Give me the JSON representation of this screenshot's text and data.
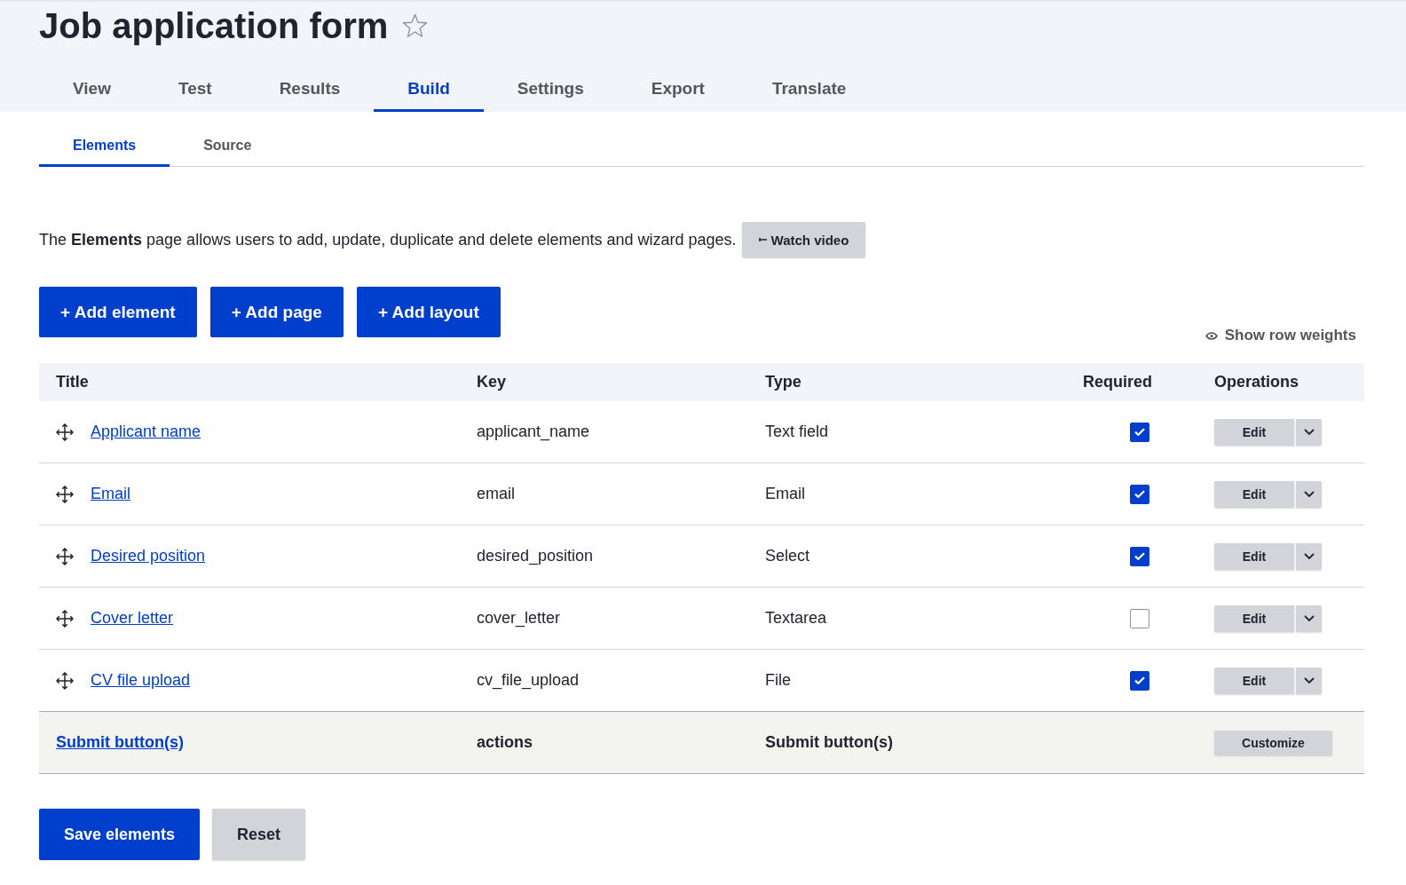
{
  "page": {
    "title": "Job application form",
    "starred": false
  },
  "primary_tabs": [
    {
      "label": "View",
      "selected": false
    },
    {
      "label": "Test",
      "selected": false
    },
    {
      "label": "Results",
      "selected": false
    },
    {
      "label": "Build",
      "selected": true
    },
    {
      "label": "Settings",
      "selected": false
    },
    {
      "label": "Export",
      "selected": false
    },
    {
      "label": "Translate",
      "selected": false
    }
  ],
  "secondary_tabs": [
    {
      "label": "Elements",
      "selected": true
    },
    {
      "label": "Source",
      "selected": false
    }
  ],
  "description": "The **Elements** page allows users to add, update, duplicate and delete elements and wizard pages.",
  "watch_video_button": "Watch video",
  "add_buttons": [
    "+ Add element",
    "+ Add page",
    "+ Add layout"
  ],
  "row_weights_toggle": "Show row weights",
  "table": {
    "columns": [
      "Title",
      "Key",
      "Type",
      "Required",
      "Operations"
    ],
    "rows": [
      {
        "title": "Applicant name",
        "key": "applicant_name",
        "type": "Text field",
        "required": true,
        "operation": "Edit"
      },
      {
        "title": "Email",
        "key": "email",
        "type": "Email",
        "required": true,
        "operation": "Edit"
      },
      {
        "title": "Desired position",
        "key": "desired_position",
        "type": "Select",
        "required": true,
        "operation": "Edit"
      },
      {
        "title": "Cover letter",
        "key": "cover_letter",
        "type": "Textarea",
        "required": false,
        "operation": "Edit"
      },
      {
        "title": "CV file upload",
        "key": "cv_file_upload",
        "type": "File",
        "required": true,
        "operation": "Edit"
      }
    ],
    "summary_row": {
      "title": "Submit button(s)",
      "key": "actions",
      "type": "Submit button(s)",
      "operation": "Customize"
    }
  },
  "form_buttons": [
    {
      "label": "Save elements",
      "kind": "primary"
    },
    {
      "label": "Reset",
      "kind": "secondary"
    }
  ]
}
